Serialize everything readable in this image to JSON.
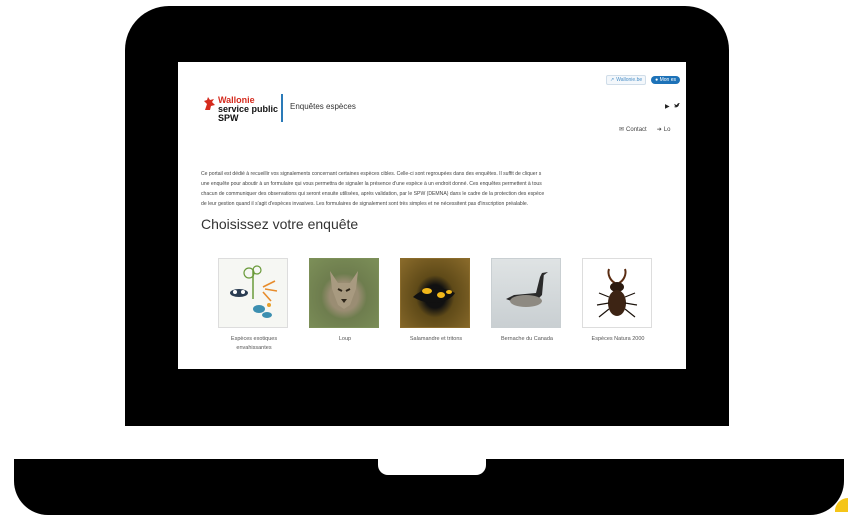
{
  "header": {
    "logo": {
      "line1": "Wallonie",
      "line2": "service public",
      "line3": "SPW"
    },
    "site_title": "Enquêtes espèces",
    "top_links": {
      "wallonie": "Wallonie.be",
      "mon_espace": "Mon es"
    },
    "utility": {
      "contact": "Contact",
      "login": "Lo"
    }
  },
  "intro": {
    "line1": "Ce portail est dédié à recueillir vos signalements concernant certaines espèces cibles.  Celle-ci sont regroupées dans des enquêtes.  Il suffit de cliquer s",
    "line2": "une enquête pour aboutir à un formulaire qui vous permettra de signaler la présence d'une espèce à un endroit donné.  Ces enquêtes permettent à tous",
    "line3": "chacun de communiquer des observations qui seront ensuite utilisées, après validation, par le SPW (DEMNA) dans le cadre de la protection des espèce",
    "line4": "de leur gestion quand il s'agit d'espèces invasives.  Les formulaires de signalement sont très simples et ne nécessitent pas d'inscription préalable."
  },
  "section_title": "Choisissez votre enquête",
  "surveys": [
    {
      "label": "Espèces exotiques envahissantes"
    },
    {
      "label": "Loup"
    },
    {
      "label": "Salamandre et tritons"
    },
    {
      "label": "Bernache du Canada"
    },
    {
      "label": "Espèces Natura 2000"
    }
  ],
  "colors": {
    "brand_red": "#d52b1e",
    "accent_blue": "#1d72b8",
    "divider_blue": "#2a7ab8",
    "laptop_accent": "#f5c518"
  }
}
